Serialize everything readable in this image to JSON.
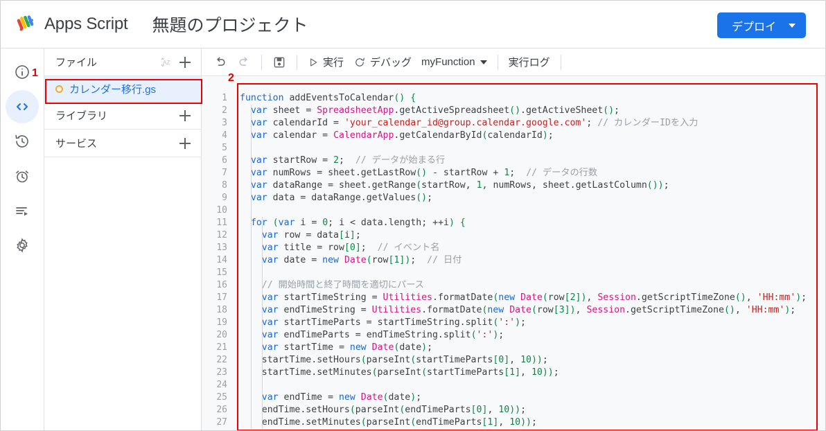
{
  "window": {
    "app_name": "Apps Script",
    "project_title": "無題のプロジェクト",
    "deploy_label": "デプロイ"
  },
  "rail": {
    "items": [
      {
        "name": "overview-icon",
        "tooltip": "概要"
      },
      {
        "name": "editor-icon",
        "tooltip": "エディタ"
      },
      {
        "name": "history-icon",
        "tooltip": "実行数"
      },
      {
        "name": "triggers-icon",
        "tooltip": "トリガー"
      },
      {
        "name": "executions-icon",
        "tooltip": "実行ログ"
      },
      {
        "name": "settings-icon",
        "tooltip": "プロジェクトの設定"
      }
    ]
  },
  "file_panel": {
    "files_header": "ファイル",
    "sort_icon": "sort-az-icon",
    "add_icon": "plus-icon",
    "file": {
      "name": "カレンダー移行.gs",
      "status_icon": "file-status-dot"
    },
    "libraries_header": "ライブラリ",
    "services_header": "サービス"
  },
  "editor_toolbar": {
    "undo_icon": "undo-icon",
    "redo_icon": "redo-icon",
    "save_icon": "save-icon",
    "run_label": "実行",
    "run_icon": "play-icon",
    "debug_label": "デバッグ",
    "debug_icon": "debug-icon",
    "function_select": "myFunction",
    "execution_log_label": "実行ログ"
  },
  "code": {
    "line_numbers": [
      1,
      2,
      3,
      4,
      5,
      6,
      7,
      8,
      9,
      10,
      11,
      12,
      13,
      14,
      15,
      16,
      17,
      18,
      19,
      20,
      21,
      22,
      23,
      24,
      25,
      26,
      27
    ],
    "lines": [
      "function addEventsToCalendar() {",
      "  var sheet = SpreadsheetApp.getActiveSpreadsheet().getActiveSheet();",
      "  var calendarId = 'your_calendar_id@group.calendar.google.com'; // カレンダーIDを入力",
      "  var calendar = CalendarApp.getCalendarById(calendarId);",
      "",
      "  var startRow = 2;  // データが始まる行",
      "  var numRows = sheet.getLastRow() - startRow + 1;  // データの行数",
      "  var dataRange = sheet.getRange(startRow, 1, numRows, sheet.getLastColumn());",
      "  var data = dataRange.getValues();",
      "",
      "  for (var i = 0; i < data.length; ++i) {",
      "    var row = data[i];",
      "    var title = row[0];  // イベント名",
      "    var date = new Date(row[1]);  // 日付",
      "",
      "    // 開始時間と終了時間を適切にパース",
      "    var startTimeString = Utilities.formatDate(new Date(row[2]), Session.getScriptTimeZone(), 'HH:mm');",
      "    var endTimeString = Utilities.formatDate(new Date(row[3]), Session.getScriptTimeZone(), 'HH:mm');",
      "    var startTimeParts = startTimeString.split(':');",
      "    var endTimeParts = endTimeString.split(':');",
      "    var startTime = new Date(date);",
      "    startTime.setHours(parseInt(startTimeParts[0], 10));",
      "    startTime.setMinutes(parseInt(startTimeParts[1], 10));",
      "",
      "    var endTime = new Date(date);",
      "    endTime.setHours(parseInt(endTimeParts[0], 10));",
      "    endTime.setMinutes(parseInt(endTimeParts[1], 10));"
    ]
  },
  "annotations": [
    {
      "label": "1",
      "target": "file-row-callout"
    },
    {
      "label": "2",
      "target": "code-editor-callout"
    }
  ],
  "colors": {
    "accent_blue": "#1a73e8",
    "annotation_red": "#ee0000",
    "selected_row_bg": "#e8f0fe",
    "editor_bg": "#f8f9fa"
  }
}
